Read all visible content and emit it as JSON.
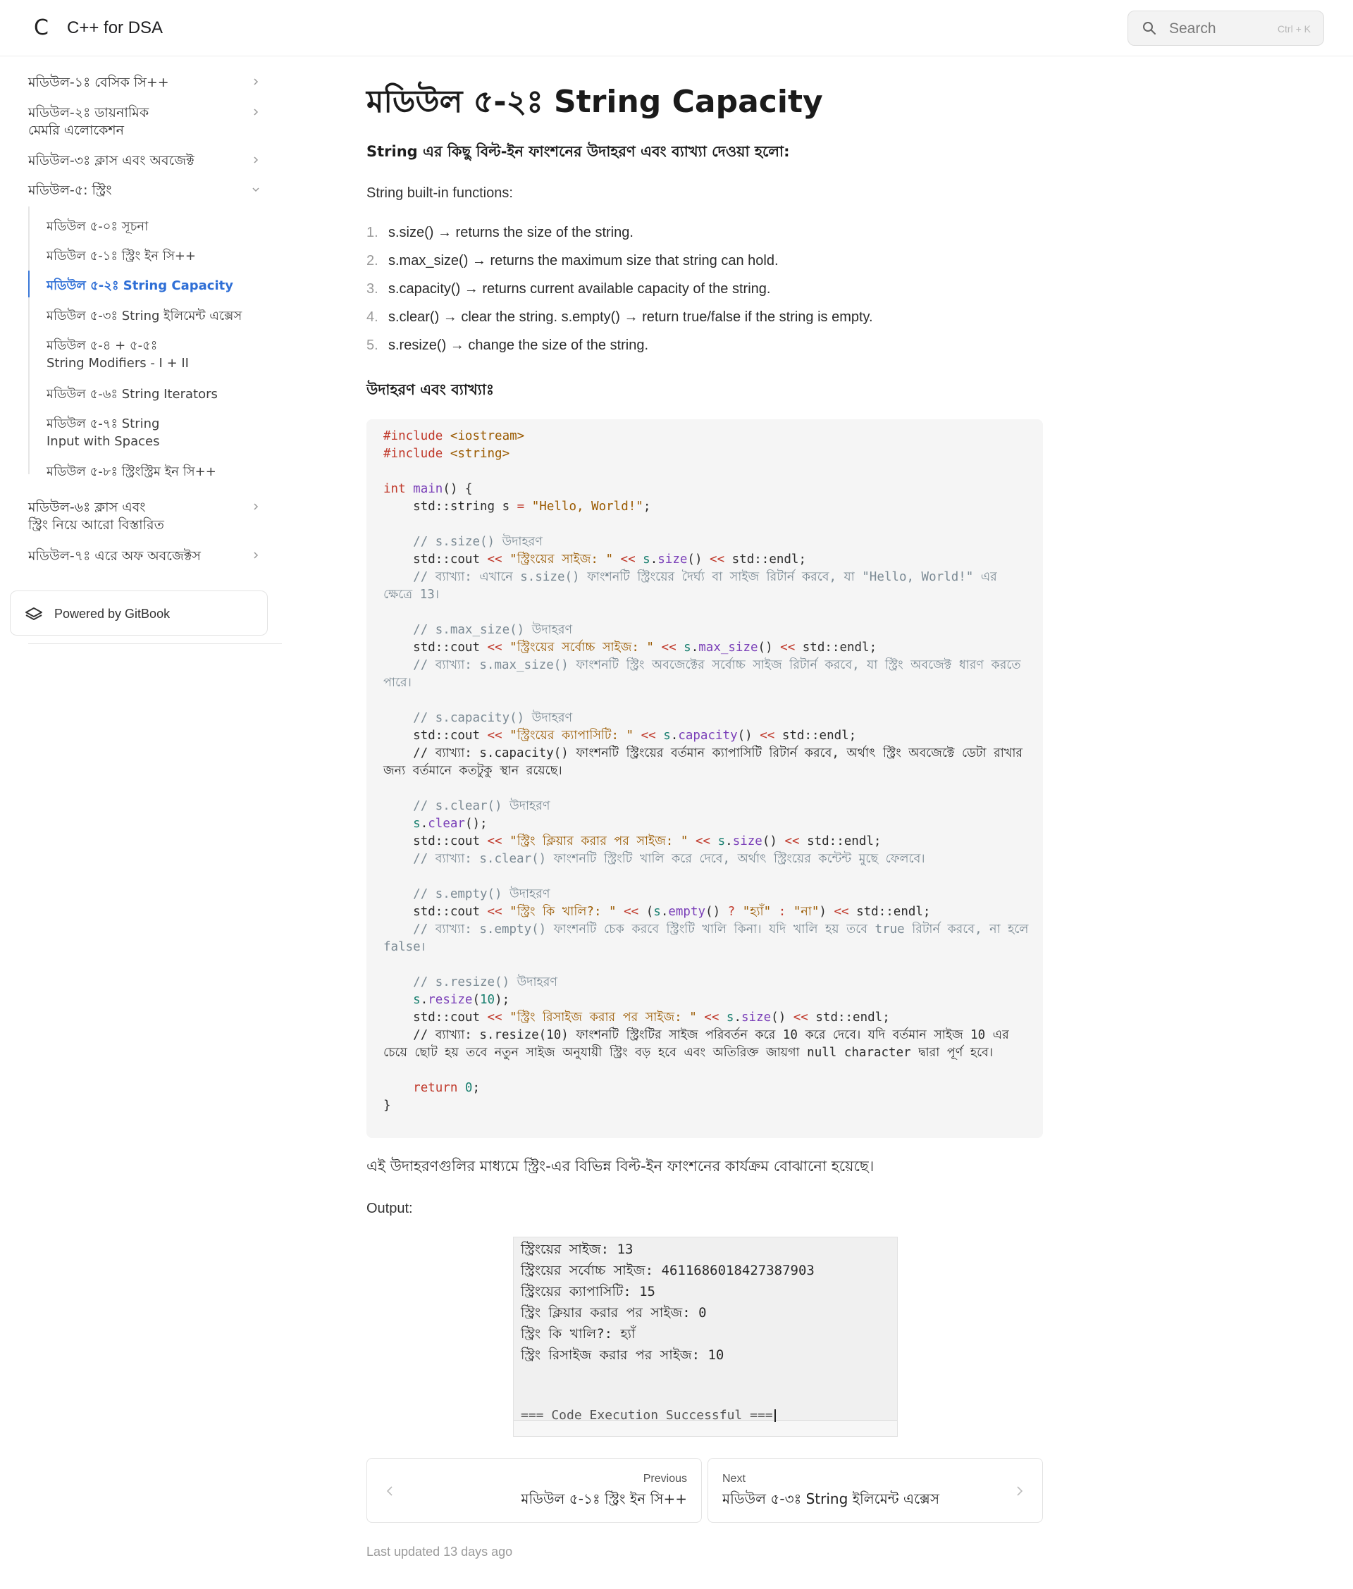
{
  "header": {
    "logo_glyph": "C",
    "site_title": "C++ for DSA",
    "search_placeholder": "Search",
    "search_shortcut": "Ctrl + K"
  },
  "sidebar": {
    "modules": [
      {
        "line1": "মডিউল-১ঃ বেসিক সি++",
        "line2": "",
        "expanded": false
      },
      {
        "line1": "মডিউল-২ঃ ডায়নামিক",
        "line2": "মেমরি এলোকেশন",
        "expanded": false
      },
      {
        "line1": "মডিউল-৩ঃ ক্লাস এবং অবজেক্ট",
        "line2": "",
        "expanded": false
      },
      {
        "line1": "মডিউল-৫: স্ট্রিং",
        "line2": "",
        "expanded": true
      },
      {
        "line1": "মডিউল-৬ঃ ক্লাস এবং",
        "line2": "স্ট্রিং নিয়ে আরো বিস্তারিত",
        "expanded": false
      },
      {
        "line1": "মডিউল-৭ঃ এরে অফ অবজেক্টস",
        "line2": "",
        "expanded": false
      }
    ],
    "sub_items": [
      {
        "line1": "মডিউল ৫-০ঃ সূচনা",
        "line2": ""
      },
      {
        "line1": "মডিউল ৫-১ঃ স্ট্রিং ইন সি++",
        "line2": ""
      },
      {
        "line1": "মডিউল ৫-২ঃ String Capacity",
        "line2": ""
      },
      {
        "line1": "মডিউল ৫-৩ঃ String ইলিমেন্ট এক্সেস",
        "line2": ""
      },
      {
        "line1": "মডিউল ৫-৪ + ৫-৫ঃ",
        "line2": "String Modifiers - I + II"
      },
      {
        "line1": "মডিউল ৫-৬ঃ String Iterators",
        "line2": ""
      },
      {
        "line1": "মডিউল ৫-৭ঃ String",
        "line2": "Input with Spaces"
      },
      {
        "line1": "মডিউল ৫-৮ঃ স্ট্রিংস্ট্রিম ইন সি++",
        "line2": ""
      }
    ],
    "active_sub_index": 2,
    "powered_by": "Powered by GitBook"
  },
  "main": {
    "title": "মডিউল ৫-২ঃ String Capacity",
    "intro": "String এর কিছু বিল্ট-ইন ফাংশনের উদাহরণ এবং ব্যাখ্যা দেওয়া হলো:",
    "list_intro": "String built-in functions:",
    "list": [
      "s.size() → returns the size of the string.",
      "s.max_size() → returns the maximum size that string can hold.",
      "s.capacity() → returns current available capacity of the string.",
      "s.clear() → clear the string. s.empty() → return true/false if the string is empty.",
      "s.resize() → change the size of the string."
    ],
    "example_heading": "উদাহরণ এবং ব্যাখ্যাঃ",
    "after_code": "এই উদাহরণগুলির মাধ্যমে স্ট্রিং-এর বিভিন্ন বিল্ট-ইন ফাংশনের কার্যক্রম বোঝানো হয়েছে।",
    "output_label": "Output:",
    "output_lines": [
      "স্ট্রিংয়ের সাইজ: 13",
      "স্ট্রিংয়ের সর্বোচ্চ সাইজ: 4611686018427387903",
      "স্ট্রিংয়ের ক্যাপাসিটি: 15",
      "স্ট্রিং ক্লিয়ার করার পর সাইজ: 0",
      "স্ট্রিং কি খালি?: হ্যাঁ",
      "স্ট্রিং রিসাইজ করার পর সাইজ: 10"
    ],
    "output_footer": "=== Code Execution Successful ===",
    "prev_label": "Previous",
    "prev_title": "মডিউল ৫-১ঃ স্ট্রিং ইন সি++",
    "next_label": "Next",
    "next_title": "মডিউল ৫-৩ঃ String ইলিমেন্ট এক্সেস",
    "last_updated": "Last updated 13 days ago"
  },
  "code": {
    "include1_kw": "#include",
    "include1_hdr": "<iostream>",
    "include2_kw": "#include",
    "include2_hdr": "<string>",
    "main_sig": "main",
    "str_literal": "\"Hello, World!\"",
    "c_size": "// s.size() উদাহরণ",
    "s_size": "\"স্ট্রিংয়ের সাইজ: \"",
    "e_size": "// ব্যাখ্যা: এখানে s.size() ফাংশনটি স্ট্রিংয়ের দৈর্ঘ্য বা সাইজ রিটার্ন করবে, যা \"Hello, World!\" এর ক্ষেত্রে 13।",
    "c_max": "// s.max_size() উদাহরণ",
    "s_max": "\"স্ট্রিংয়ের সর্বোচ্চ সাইজ: \"",
    "e_max": "// ব্যাখ্যা: s.max_size() ফাংশনটি স্ট্রিং অবজেক্টের সর্বোচ্চ সাইজ রিটার্ন করবে, যা স্ট্রিং অবজেক্ট ধারণ করতে পারে।",
    "c_cap": "// s.capacity() উদাহরণ",
    "s_cap": "\"স্ট্রিংয়ের ক্যাপাসিটি: \"",
    "e_cap": "// ব্যাখ্যা: s.capacity() ফাংশনটি স্ট্রিংয়ের বর্তমান ক্যাপাসিটি রিটার্ন করবে, অর্থাৎ স্ট্রিং অবজেক্টে ডেটা রাখার জন্য বর্তমানে কতটুকু স্থান রয়েছে।",
    "c_clear": "// s.clear() উদাহরণ",
    "s_clear": "\"স্ট্রিং ক্লিয়ার করার পর সাইজ: \"",
    "e_clear": "// ব্যাখ্যা: s.clear() ফাংশনটি স্ট্রিংটি খালি করে দেবে, অর্থাৎ স্ট্রিংয়ের কন্টেন্ট মুছে ফেলবে।",
    "c_empty": "// s.empty() উদাহরণ",
    "s_empty": "\"স্ট্রিং কি খালি?: \"",
    "s_yes": "\"হ্যাঁ\"",
    "s_no": "\"না\"",
    "e_empty": "// ব্যাখ্যা: s.empty() ফাংশনটি চেক করবে স্ট্রিংটি খালি কিনা। যদি খালি হয় তবে true রিটার্ন করবে, না হলে false।",
    "c_resize": "// s.resize() উদাহরণ",
    "s_resize": "\"স্ট্রিং রিসাইজ করার পর সাইজ: \"",
    "e_resize": "// ব্যাখ্যা: s.resize(10) ফাংশনটি স্ট্রিংটির সাইজ পরিবর্তন করে 10 করে দেবে। যদি বর্তমান সাইজ 10 এর চেয়ে ছোট হয় তবে নতুন সাইজ অনুযায়ী স্ট্রিং বড় হবে এবং অতিরিক্ত জায়গা null character দ্বারা পূর্ণ হবে।"
  }
}
